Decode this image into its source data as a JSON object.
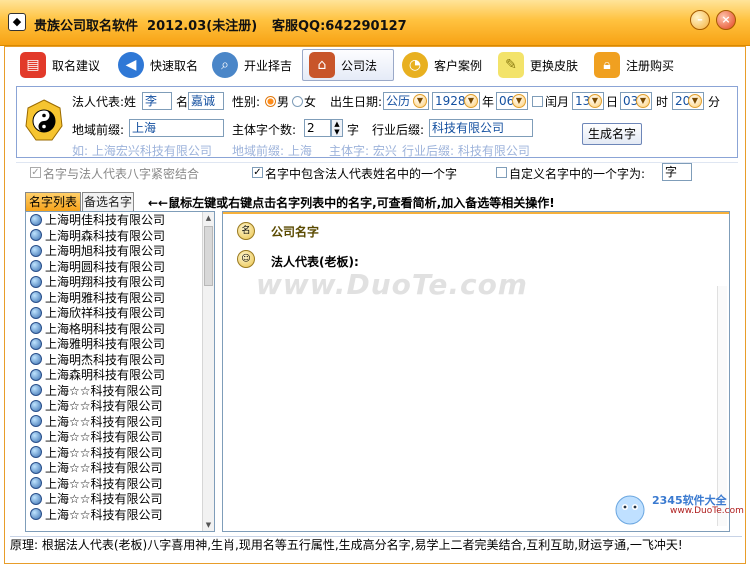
{
  "window": {
    "title": "贵族公司取名软件  2012.03(未注册)",
    "service": "客服QQ:642290127"
  },
  "toolbar": {
    "items": [
      {
        "label": "取名建议"
      },
      {
        "label": "快速取名"
      },
      {
        "label": "开业择吉"
      },
      {
        "label": "公司法"
      },
      {
        "label": "客户案例"
      },
      {
        "label": "更换皮肤"
      },
      {
        "label": "注册购买"
      }
    ]
  },
  "form": {
    "legal_rep_label": "法人代表:姓",
    "surname": "李",
    "given_label": "名",
    "given_name": "嘉诚",
    "gender_label": "性别:",
    "male": "男",
    "female": "女",
    "birth_label": "出生日期:",
    "calendar": "公历",
    "year": "1928",
    "year_unit": "年",
    "month": "06",
    "leap_label": "闰月",
    "leap_month": "13",
    "day_unit": "日",
    "day": "03",
    "hour_unit": "时",
    "hour": "20",
    "minute_unit": "分",
    "region_label": "地域前缀:",
    "region": "上海",
    "main_count_label": "主体字个数:",
    "main_count": "2",
    "main_count_unit": "字",
    "industry_label": "行业后缀:",
    "industry": "科技有限公司",
    "generate": "生成名字",
    "example_prefix": "如: 上海宏兴科技有限公司",
    "example_region": "地域前缀: 上海",
    "example_main": "主体字: 宏兴",
    "example_industry": "行业后缀: 科技有限公司"
  },
  "options": {
    "bazi": "名字与法人代表八字紧密结合",
    "include_char": "名字中包含法人代表姓名中的一个字",
    "custom_label": "自定义名字中的一个字为:",
    "custom_char": "字"
  },
  "tabs": {
    "name_list": "名字列表",
    "candidates": "备选名字",
    "hint": "←←鼠标左键或右键点击名字列表中的名字,可查看简析,加入备选等相关操作!"
  },
  "names": [
    "上海明佳科技有限公司",
    "上海明森科技有限公司",
    "上海明旭科技有限公司",
    "上海明圆科技有限公司",
    "上海明翔科技有限公司",
    "上海明雅科技有限公司",
    "上海欣祥科技有限公司",
    "上海格明科技有限公司",
    "上海雅明科技有限公司",
    "上海明杰科技有限公司",
    "上海森明科技有限公司",
    "上海☆☆科技有限公司",
    "上海☆☆科技有限公司",
    "上海☆☆科技有限公司",
    "上海☆☆科技有限公司",
    "上海☆☆科技有限公司",
    "上海☆☆科技有限公司",
    "上海☆☆科技有限公司",
    "上海☆☆科技有限公司",
    "上海☆☆科技有限公司"
  ],
  "detail": {
    "company_label": "公司名字",
    "rep_label": "法人代表(老板):"
  },
  "watermark": {
    "site": "www.DuoTe.com",
    "logo_name": "2345软件大全",
    "logo_url": "www.DuoTe.com"
  },
  "status": "原理: 根据法人代表(老板)八字喜用神,生肖,现用名等五行属性,生成高分名字,易学上二者完美结合,互利互助,财运亨通,一飞冲天!"
}
